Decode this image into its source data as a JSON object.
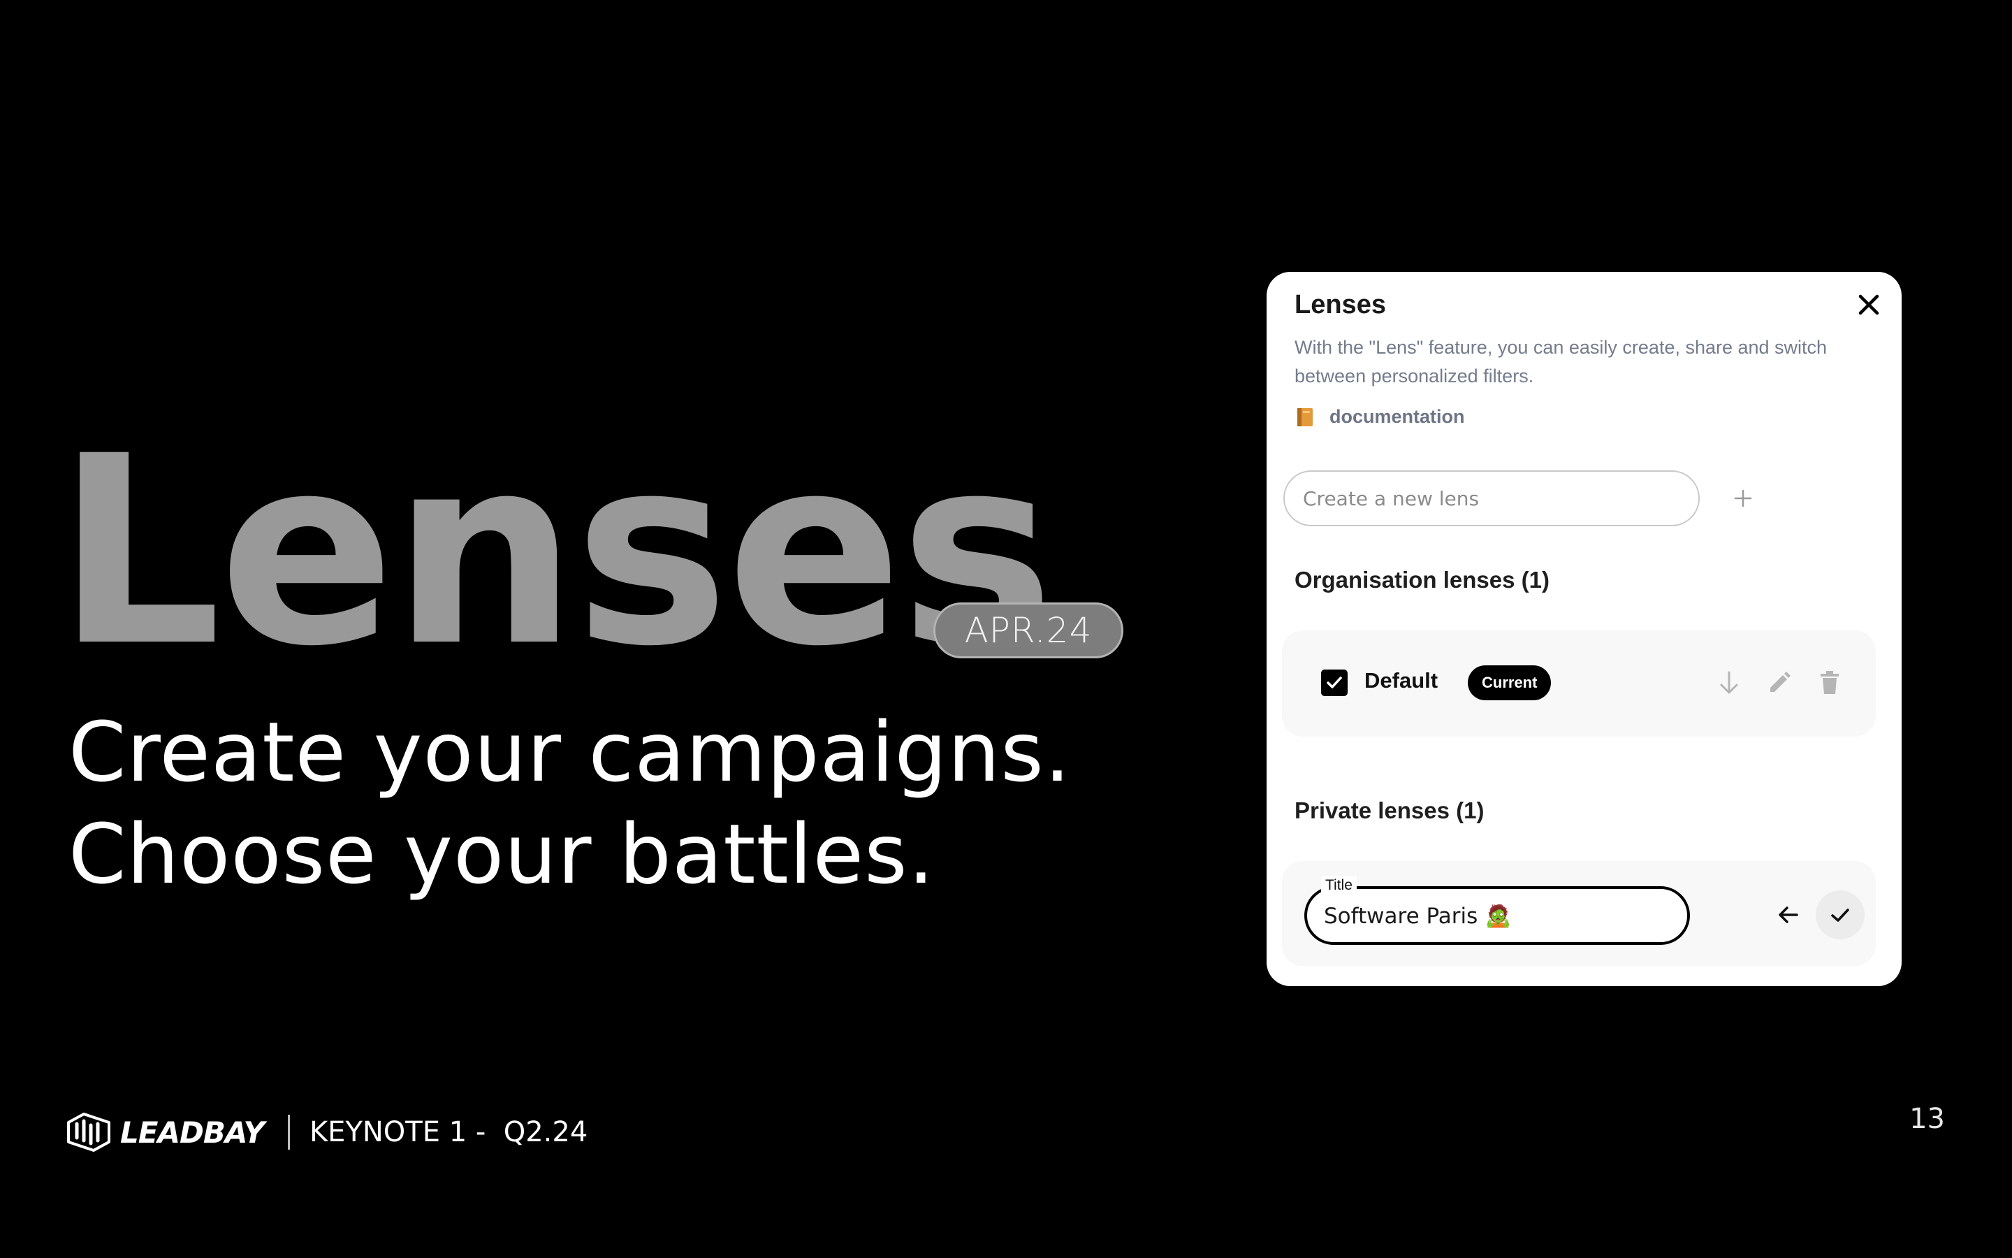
{
  "slide": {
    "hero_title": "Lenses",
    "date_badge": "APR.24",
    "tagline_line1": "Create your campaigns.",
    "tagline_line2": "Choose your battles.",
    "page_number": "13"
  },
  "footer": {
    "brand": "LEADBAY",
    "keynote": "KEYNOTE 1 -  Q2.24"
  },
  "modal": {
    "title": "Lenses",
    "description": "With the \"Lens\" feature, you can easily create, share and switch between personalized filters.",
    "doc_link": "documentation",
    "new_lens_placeholder": "Create a new lens",
    "org_section_title": "Organisation lenses (1)",
    "private_section_title": "Private lenses (1)",
    "org_lenses": [
      {
        "name": "Default",
        "badge": "Current",
        "checked": true
      }
    ],
    "private_edit": {
      "field_label": "Title",
      "value": "Software Paris 🧟"
    }
  },
  "colors": {
    "background": "#000000",
    "hero_text": "#999999",
    "modal_bg": "#ffffff",
    "muted_text": "#747b8c",
    "card_bg": "#f8f8f8",
    "accent": "#000000"
  },
  "icons": [
    "close-icon",
    "book-icon",
    "plus-icon",
    "checkbox-checked-icon",
    "arrow-down-icon",
    "pencil-icon",
    "trash-icon",
    "arrow-left-icon",
    "check-icon",
    "leadbay-logo-icon"
  ]
}
